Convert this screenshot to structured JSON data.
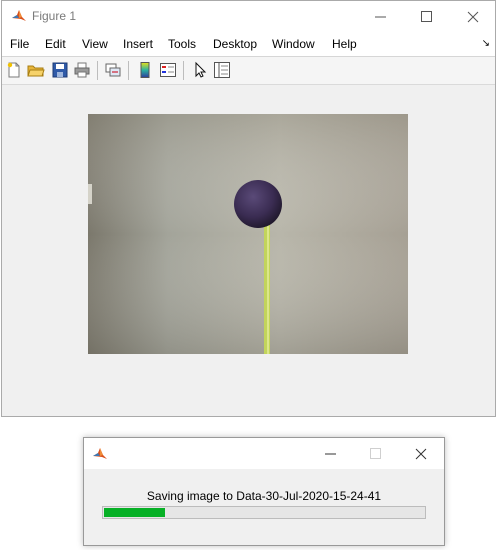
{
  "figure_window": {
    "title": "Figure 1",
    "menu": [
      "File",
      "Edit",
      "View",
      "Insert",
      "Tools",
      "Desktop",
      "Window",
      "Help"
    ],
    "dock_glyph": "↘",
    "toolbar_icons": [
      "new-figure-icon",
      "open-file-icon",
      "save-icon",
      "print-icon",
      "link-plot-icon",
      "insert-colorbar-icon",
      "insert-legend-icon",
      "edit-plot-pointer-icon",
      "property-inspector-icon"
    ]
  },
  "progress_dialog": {
    "message": "Saving image to Data-30-Jul-2020-15-24-41",
    "progress": 0.19,
    "bar_color": "#06b025"
  },
  "colors": {
    "matlab_icon": "#d9501c",
    "title_text": "#7a7a7a"
  }
}
